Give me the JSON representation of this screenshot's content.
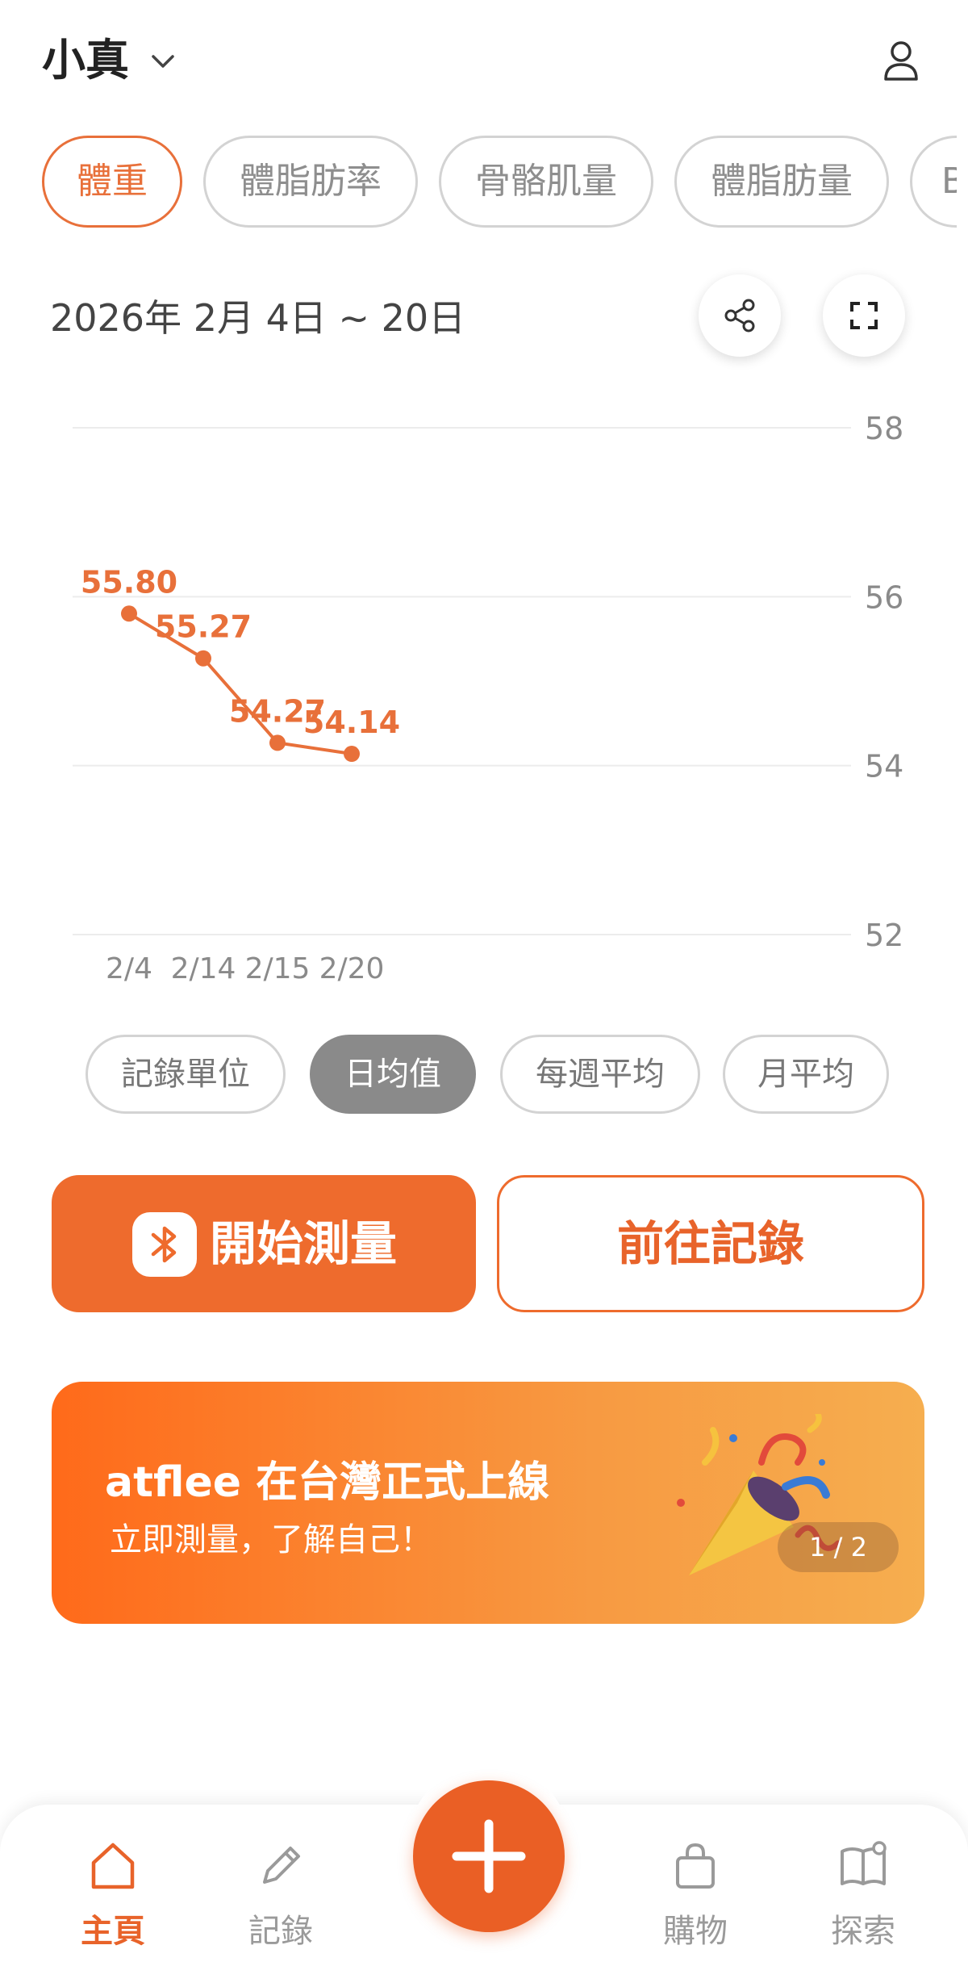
{
  "header": {
    "profile_name": "小真"
  },
  "metric_tabs": [
    {
      "label": "體重",
      "active": true
    },
    {
      "label": "體脂肪率",
      "active": false
    },
    {
      "label": "骨骼肌量",
      "active": false
    },
    {
      "label": "體脂肪量",
      "active": false
    },
    {
      "label": "B",
      "active": false
    }
  ],
  "date_range": "2026年 2月 4日 ~ 20日",
  "icons": {
    "share": "share-icon",
    "fullscreen": "fullscreen-icon",
    "user": "user-icon",
    "bluetooth": "bluetooth-icon",
    "add": "plus-icon"
  },
  "chart_data": {
    "type": "line",
    "title": "",
    "xlabel": "",
    "ylabel": "",
    "categories": [
      "2/4",
      "2/14",
      "2/15",
      "2/20"
    ],
    "series": [
      {
        "values": [
          55.8,
          55.27,
          54.27,
          54.14
        ]
      }
    ],
    "data_labels": [
      "55.80",
      "55.27",
      "54.27",
      "54.14"
    ],
    "yticks": [
      "58",
      "56",
      "54",
      "52"
    ],
    "ylim": [
      52,
      58
    ],
    "y_axis_side": "right",
    "grid": true,
    "color": "#e8703a"
  },
  "aggregation_tabs": [
    {
      "label": "記錄單位",
      "active": false
    },
    {
      "label": "日均值",
      "active": true
    },
    {
      "label": "每週平均",
      "active": false
    },
    {
      "label": "月平均",
      "active": false
    }
  ],
  "actions": {
    "measure_label": "開始測量",
    "records_label": "前往記錄"
  },
  "banner": {
    "title": "atflee 在台灣正式上線",
    "subtitle": "立即測量，了解自己！",
    "pager": "1 / 2"
  },
  "bottom_nav": [
    {
      "label": "主頁",
      "icon": "home-icon",
      "active": true
    },
    {
      "label": "記錄",
      "icon": "pencil-icon",
      "active": false
    },
    {
      "label": "購物",
      "icon": "shopping-bag-icon",
      "active": false
    },
    {
      "label": "探索",
      "icon": "book-icon",
      "active": false
    }
  ],
  "colors": {
    "accent": "#e8703a",
    "fab": "#ea5f25",
    "inactive_gray": "#8a8a8a"
  }
}
